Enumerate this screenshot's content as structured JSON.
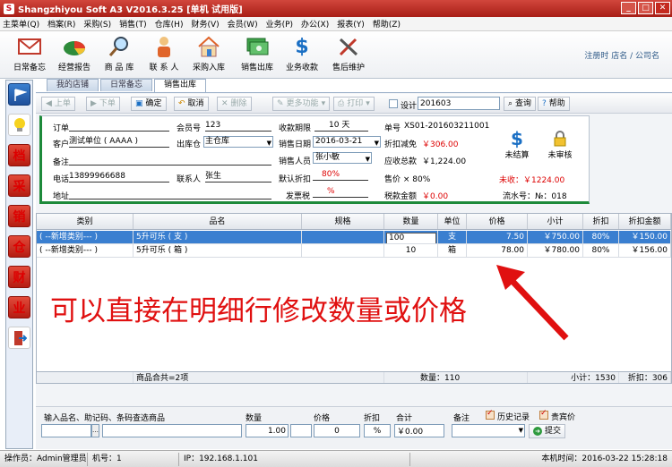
{
  "window": {
    "title": "Shangzhiyou Soft A3 V2016.3.25 [单机 试用版]",
    "btn_min": "_",
    "btn_max": "□",
    "btn_close": "✕"
  },
  "menu": [
    "主菜单(Q)",
    "档案(R)",
    "采购(S)",
    "销售(T)",
    "仓库(H)",
    "财务(V)",
    "会员(W)",
    "业务(P)",
    "办公(X)",
    "报表(Y)",
    "帮助(Z)"
  ],
  "toolbar": [
    "日常备忘",
    "经营报告",
    "商 品 库",
    "联 系 人",
    "采购入库",
    "销售出库",
    "业务收款",
    "售后维护"
  ],
  "login_info": "注册时 店名 / 公司名",
  "sidebar": {
    "labels": [
      "档",
      "采",
      "销",
      "仓",
      "财",
      "业"
    ]
  },
  "tabs": [
    "我的店铺",
    "日常备忘",
    "销售出库"
  ],
  "actions": {
    "prev": "上单",
    "next": "下单",
    "confirm": "确定",
    "cancel": "取消",
    "delete": "删除",
    "more": "更多功能",
    "print": "打印",
    "setting": "设计",
    "period": "201603",
    "query": "查询",
    "help": "帮助"
  },
  "form": {
    "order_label": "订单",
    "member_label": "会员号",
    "member_value": "123",
    "credit_label": "收款期限",
    "credit_value": "10",
    "credit_unit": "天",
    "doc_label": "单号",
    "doc_value": "XS01-201603211001",
    "customer_label": "客户",
    "customer_value": "测试单位 ( AAAA )",
    "warehouse_label": "出库仓",
    "warehouse_value": "主仓库",
    "date_label": "销售日期",
    "date_value": "2016-03-21",
    "discount_amt_label": "折扣减免",
    "discount_amt_value": "￥306.00",
    "note_label": "备注",
    "salesman_label": "销售人员",
    "salesman_value": "张小敏",
    "receivable_label": "应收总款",
    "receivable_value": "￥1,224.00",
    "phone_label": "电话",
    "phone_value": "13899966688",
    "contact_label": "联系人",
    "contact_value": "张生",
    "default_discount_label": "默认折扣",
    "default_discount_value": "80%",
    "price_label": "售价 × 80%",
    "address_label": "地址",
    "tax_rate_label": "发票税",
    "tax_rate_value": "%",
    "tax_amt_label": "税款金额",
    "tax_amt_value": "￥0.00",
    "unsettled_label": "未结算",
    "unaudited_label": "未审核",
    "unpaid": "未收：￥1224.00",
    "serial": "流水号：№：018"
  },
  "grid": {
    "headers": [
      "类别",
      "品名",
      "规格",
      "数量",
      "单位",
      "价格",
      "小计",
      "折扣",
      "折扣金额"
    ],
    "rows": [
      {
        "cat": "( --新增类别--- )",
        "name": "5升可乐 ( 支 )",
        "spec": "",
        "qty": "100",
        "unit": "支",
        "price": "7.50",
        "subtotal": "￥750.00",
        "disc": "80%",
        "disc_amt": "￥150.00"
      },
      {
        "cat": "( --新增类别--- )",
        "name": "5升可乐 ( 箱 )",
        "spec": "",
        "qty": "10",
        "unit": "箱",
        "price": "78.00",
        "subtotal": "￥780.00",
        "disc": "80%",
        "disc_amt": "￥156.00"
      }
    ],
    "footer": {
      "items": "商品合共=2项",
      "qty": "数量：110",
      "subtotal": "小计：1530",
      "disc_amt": "折扣：306"
    }
  },
  "annotation": "可以直接在明细行修改数量或价格",
  "entry": {
    "item_label": "输入品名、助记码、条码查选商品",
    "qty_label": "数量",
    "qty_value": "1.00",
    "price_label": "价格",
    "price_value": "0",
    "disc_label": "折扣",
    "disc_value": "%",
    "total_label": "合计",
    "total_value": "￥0.00",
    "note_label": "备注",
    "history_label": "历史记录",
    "vip_label": "贵宾价",
    "submit": "提交"
  },
  "status": {
    "operator": "操作员：Admin管理员",
    "machine": "机号：1",
    "ip": "IP：192.168.1.101",
    "time": "本机时间：2016-03-22 15:28:18"
  }
}
